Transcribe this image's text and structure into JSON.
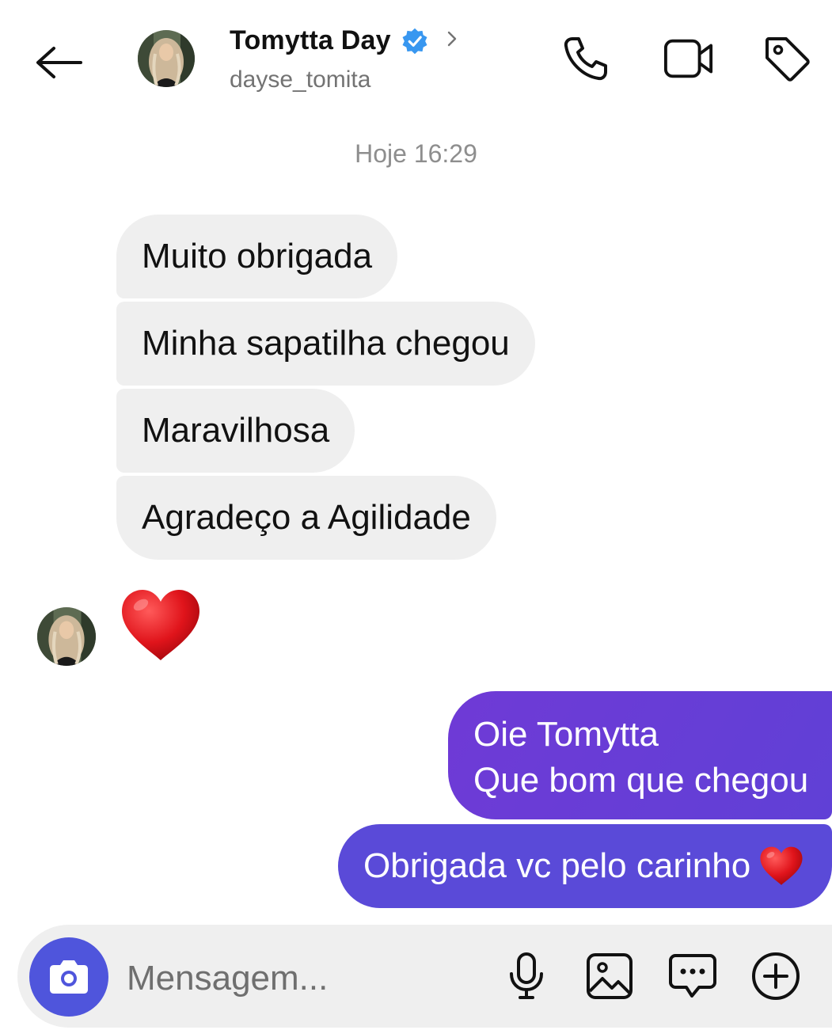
{
  "header": {
    "name": "Tomytta Day",
    "username": "dayse_tomita",
    "verified": true,
    "icons": [
      "back-arrow-icon",
      "verified-badge-icon",
      "chevron-right-icon",
      "phone-icon",
      "video-camera-icon",
      "tag-icon"
    ]
  },
  "conversation": {
    "timestamp": "Hoje 16:29",
    "incoming": [
      {
        "text": "Muito obrigada"
      },
      {
        "text": "Minha sapatilha chegou"
      },
      {
        "text": "Maravilhosa"
      },
      {
        "text": "Agradeço a Agilidade"
      }
    ],
    "incoming_reaction": "❤️",
    "outgoing": [
      {
        "line1": "Oie Tomytta",
        "line2": "Que bom que chegou"
      },
      {
        "text": "Obrigada vc pelo carinho",
        "emoji": "❤️"
      }
    ]
  },
  "composer": {
    "placeholder": "Mensagem...",
    "value": "",
    "icons": [
      "camera-icon",
      "microphone-icon",
      "image-icon",
      "sticker-chat-icon",
      "plus-circle-icon"
    ]
  },
  "colors": {
    "incoming_bubble": "#efefef",
    "outgoing_bubble_1": "#6a3dd6",
    "outgoing_bubble_2": "#5a4ad8",
    "camera_button": "#4f55dc",
    "verified_badge": "#3897f0",
    "muted_text": "#8e8e8e"
  }
}
